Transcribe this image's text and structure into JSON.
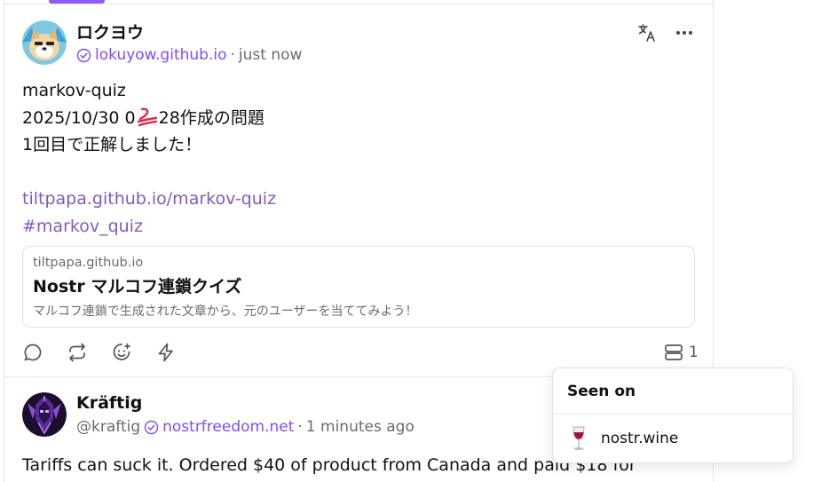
{
  "feed": {
    "posts": [
      {
        "author_name": "ロクヨウ",
        "nip05": "lokuyow.github.io",
        "separator": "·",
        "timestamp": "just now",
        "content": {
          "line1": "markov-quiz",
          "line2_prefix": "2025/10/30 0",
          "line2_suffix": "28作成の問題",
          "line3": "1回目で正解しました！",
          "link_url": "tiltpapa.github.io/markov-quiz",
          "hashtag": "#markov_quiz"
        },
        "link_preview": {
          "domain": "tiltpapa.github.io",
          "title": "Nostr マルコフ連鎖クイズ",
          "description": "マルコフ連鎖で生成された文章から、元のユーザーを当ててみよう！"
        },
        "seen_on_count": "1"
      },
      {
        "author_name": "Kräftig",
        "handle": "@kraftig",
        "nip05": "nostrfreedom.net",
        "separator": "·",
        "timestamp": "1 minutes ago",
        "content_line1": "Tariffs can suck it. Ordered $40 of product from Canada and paid $18 for"
      }
    ]
  },
  "popover": {
    "title": "Seen on",
    "relays": [
      {
        "name": "nostr.wine",
        "icon": "wine-glass-icon"
      }
    ]
  },
  "colors": {
    "accent": "#7c4dff",
    "link": "#7c5cc4",
    "tab_indicator": "#8b5cf6",
    "muted_text": "#6b6b6b"
  },
  "icons": {
    "translate": "translate-icon",
    "more": "more-horizontal-icon",
    "reply": "reply-icon",
    "repost": "repost-icon",
    "react": "emoji-react-icon",
    "zap": "zap-icon",
    "seen_on": "server-icon",
    "verified": "verified-check-icon"
  }
}
